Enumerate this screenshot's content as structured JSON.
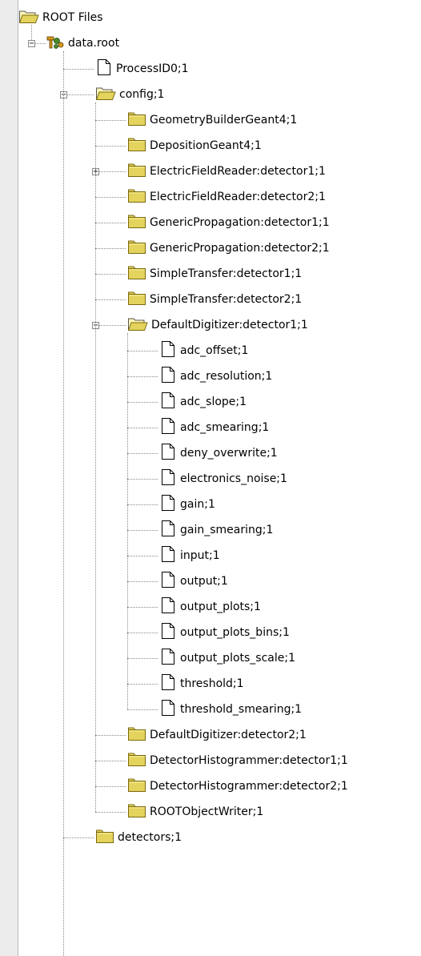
{
  "tree": {
    "root": {
      "label": "ROOT Files",
      "icon": "folder-open-icon"
    },
    "file": {
      "label": "data.root",
      "icon": "root-file-icon",
      "expanded": true
    },
    "rows": [
      {
        "label": "ProcessID0;1",
        "icon": "document-icon",
        "level": 2
      },
      {
        "label": "config;1",
        "icon": "folder-open-icon",
        "level": 2,
        "expanded": true
      },
      {
        "label": "GeometryBuilderGeant4;1",
        "icon": "folder-icon",
        "level": 3
      },
      {
        "label": "DepositionGeant4;1",
        "icon": "folder-icon",
        "level": 3
      },
      {
        "label": "ElectricFieldReader:detector1;1",
        "icon": "folder-icon",
        "level": 3,
        "expanded": false
      },
      {
        "label": "ElectricFieldReader:detector2;1",
        "icon": "folder-icon",
        "level": 3
      },
      {
        "label": "GenericPropagation:detector1;1",
        "icon": "folder-icon",
        "level": 3
      },
      {
        "label": "GenericPropagation:detector2;1",
        "icon": "folder-icon",
        "level": 3
      },
      {
        "label": "SimpleTransfer:detector1;1",
        "icon": "folder-icon",
        "level": 3
      },
      {
        "label": "SimpleTransfer:detector2;1",
        "icon": "folder-icon",
        "level": 3
      },
      {
        "label": "DefaultDigitizer:detector1;1",
        "icon": "folder-open-icon",
        "level": 3,
        "expanded": true
      },
      {
        "label": "adc_offset;1",
        "icon": "document-icon",
        "level": 4
      },
      {
        "label": "adc_resolution;1",
        "icon": "document-icon",
        "level": 4
      },
      {
        "label": "adc_slope;1",
        "icon": "document-icon",
        "level": 4
      },
      {
        "label": "adc_smearing;1",
        "icon": "document-icon",
        "level": 4
      },
      {
        "label": "deny_overwrite;1",
        "icon": "document-icon",
        "level": 4
      },
      {
        "label": "electronics_noise;1",
        "icon": "document-icon",
        "level": 4
      },
      {
        "label": "gain;1",
        "icon": "document-icon",
        "level": 4
      },
      {
        "label": "gain_smearing;1",
        "icon": "document-icon",
        "level": 4
      },
      {
        "label": "input;1",
        "icon": "document-icon",
        "level": 4
      },
      {
        "label": "output;1",
        "icon": "document-icon",
        "level": 4
      },
      {
        "label": "output_plots;1",
        "icon": "document-icon",
        "level": 4
      },
      {
        "label": "output_plots_bins;1",
        "icon": "document-icon",
        "level": 4
      },
      {
        "label": "output_plots_scale;1",
        "icon": "document-icon",
        "level": 4
      },
      {
        "label": "threshold;1",
        "icon": "document-icon",
        "level": 4
      },
      {
        "label": "threshold_smearing;1",
        "icon": "document-icon",
        "level": 4
      },
      {
        "label": "DefaultDigitizer:detector2;1",
        "icon": "folder-icon",
        "level": 3
      },
      {
        "label": "DetectorHistogrammer:detector1;1",
        "icon": "folder-icon",
        "level": 3
      },
      {
        "label": "DetectorHistogrammer:detector2;1",
        "icon": "folder-icon",
        "level": 3
      },
      {
        "label": "ROOTObjectWriter;1",
        "icon": "folder-icon",
        "level": 3
      },
      {
        "label": "detectors;1",
        "icon": "folder-icon",
        "level": 2
      }
    ]
  },
  "colors": {
    "folder_fill": "#e4d35c",
    "folder_edge": "#7a6a10",
    "root_orange": "#d99a1c",
    "root_green": "#4a8a2a",
    "tree_line": "#8a8a8a",
    "panel_bg": "#ffffff",
    "window_bg": "#ececec"
  }
}
